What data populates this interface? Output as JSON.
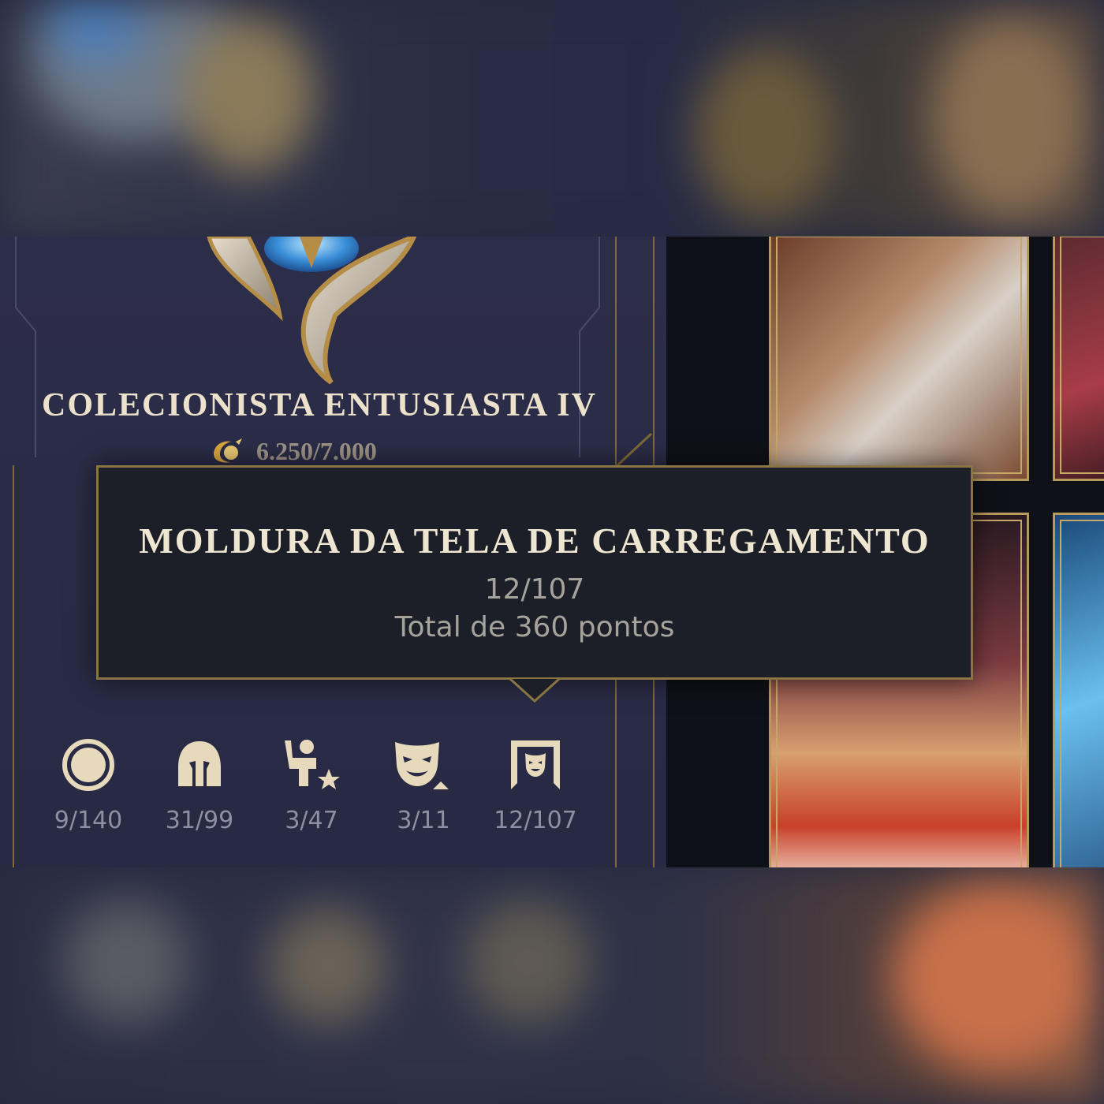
{
  "rank": {
    "title": "COLECIONISTA ENTUSIASTA IV",
    "points": "6.250/7.000",
    "points_progress": 0.893,
    "points_icon": "mastery-points-icon",
    "crest_icon": "collector-crest-icon"
  },
  "tooltip": {
    "title": "MOLDURA DA TELA DE CARREGAMENTO",
    "count": "12/107",
    "total": "Total de 360 pontos"
  },
  "stats": [
    {
      "icon": "icon-circle-ring",
      "value": "9/140"
    },
    {
      "icon": "champion-helmet-icon",
      "value": "31/99"
    },
    {
      "icon": "emote-icon",
      "value": "3/47"
    },
    {
      "icon": "skin-mask-icon",
      "value": "3/11"
    },
    {
      "icon": "loading-screen-frame-icon",
      "value": "12/107"
    }
  ],
  "colors": {
    "gold": "#c8a868",
    "panel": "#2c2d48",
    "tooltip_bg": "#1c1f27"
  }
}
